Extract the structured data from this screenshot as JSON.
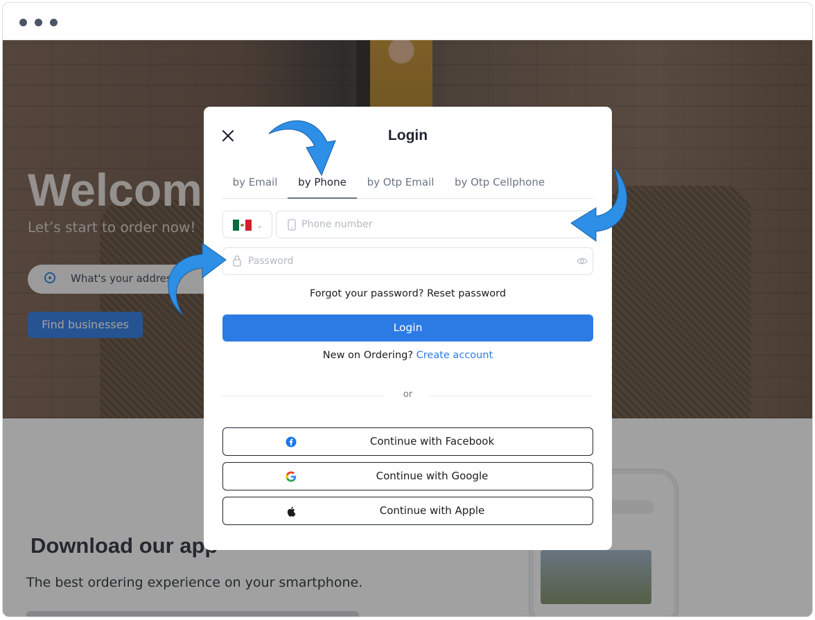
{
  "page": {
    "hero": {
      "title": "Welcome",
      "subtitle": "Let’s start to order now!",
      "address_placeholder": "What's your address?",
      "find_button": "Find businesses"
    },
    "download": {
      "title": "Download our app",
      "subtitle": "The best ordering experience on your smartphone."
    }
  },
  "modal": {
    "title": "Login",
    "close_icon": "close-icon",
    "tabs": [
      {
        "label": "by Email",
        "active": false
      },
      {
        "label": "by Phone",
        "active": true
      },
      {
        "label": "by Otp Email",
        "active": false
      },
      {
        "label": "by Otp Cellphone",
        "active": false
      }
    ],
    "country_flag": "mexico-flag-icon",
    "phone_placeholder": "Phone number",
    "password_placeholder": "Password",
    "forgot_text": "Forgot your password? Reset password",
    "login_button": "Login",
    "signup_prompt": "New on Ordering?",
    "signup_link": "Create account",
    "divider_text": "or",
    "social": [
      {
        "label": "Continue with Facebook",
        "icon": "facebook-icon"
      },
      {
        "label": "Continue with Google",
        "icon": "google-icon"
      },
      {
        "label": "Continue with Apple",
        "icon": "apple-icon"
      }
    ]
  },
  "colors": {
    "accent": "#2c7be5",
    "arrow": "#2d8fe6",
    "text": "#1f2430"
  }
}
